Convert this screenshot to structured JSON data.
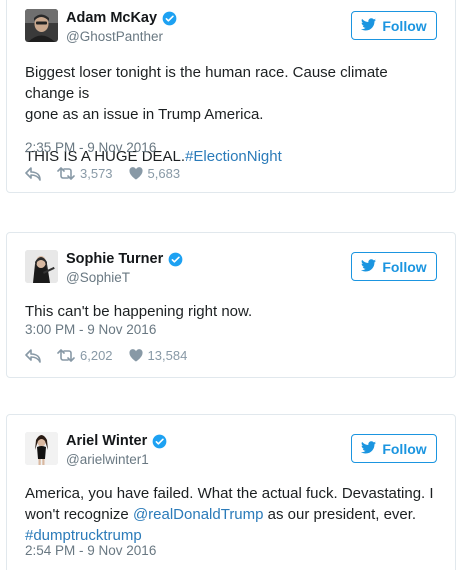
{
  "tweets": [
    {
      "name": "Adam McKay",
      "handle": "@GhostPanther",
      "follow_label": "Follow",
      "text_line1": "Biggest loser tonight is the human race. Cause climate change is",
      "text_line2": "gone as an issue in Trump America.",
      "text_line3": "THIS IS A HUGE DEAL.",
      "hashtag": "#ElectionNight",
      "timestamp": "2:35 PM - 9 Nov 2016",
      "retweets": "3,573",
      "likes": "5,683"
    },
    {
      "name": "Sophie Turner",
      "handle": "@SophieT",
      "follow_label": "Follow",
      "text": "This can't be happening right now.",
      "timestamp": "3:00 PM - 9 Nov 2016",
      "retweets": "6,202",
      "likes": "13,584"
    },
    {
      "name": "Ariel Winter",
      "handle": "@arielwinter1",
      "follow_label": "Follow",
      "text_line1": "America, you have failed. What the actual fuck. Devastating. I",
      "text_line2_pre": "won't recognize ",
      "mention": "@realDonaldTrump",
      "text_line2_post": " as our president, ever.",
      "hashtag": "#dumptrucktrump",
      "timestamp": "2:54 PM - 9 Nov 2016"
    }
  ],
  "colors": {
    "accent": "#1b95e0",
    "link": "#2b7bb9",
    "muted": "#697882",
    "action": "#8899a6"
  },
  "icons": [
    "verified-icon",
    "twitter-bird-icon",
    "reply-icon",
    "retweet-icon",
    "heart-icon"
  ]
}
